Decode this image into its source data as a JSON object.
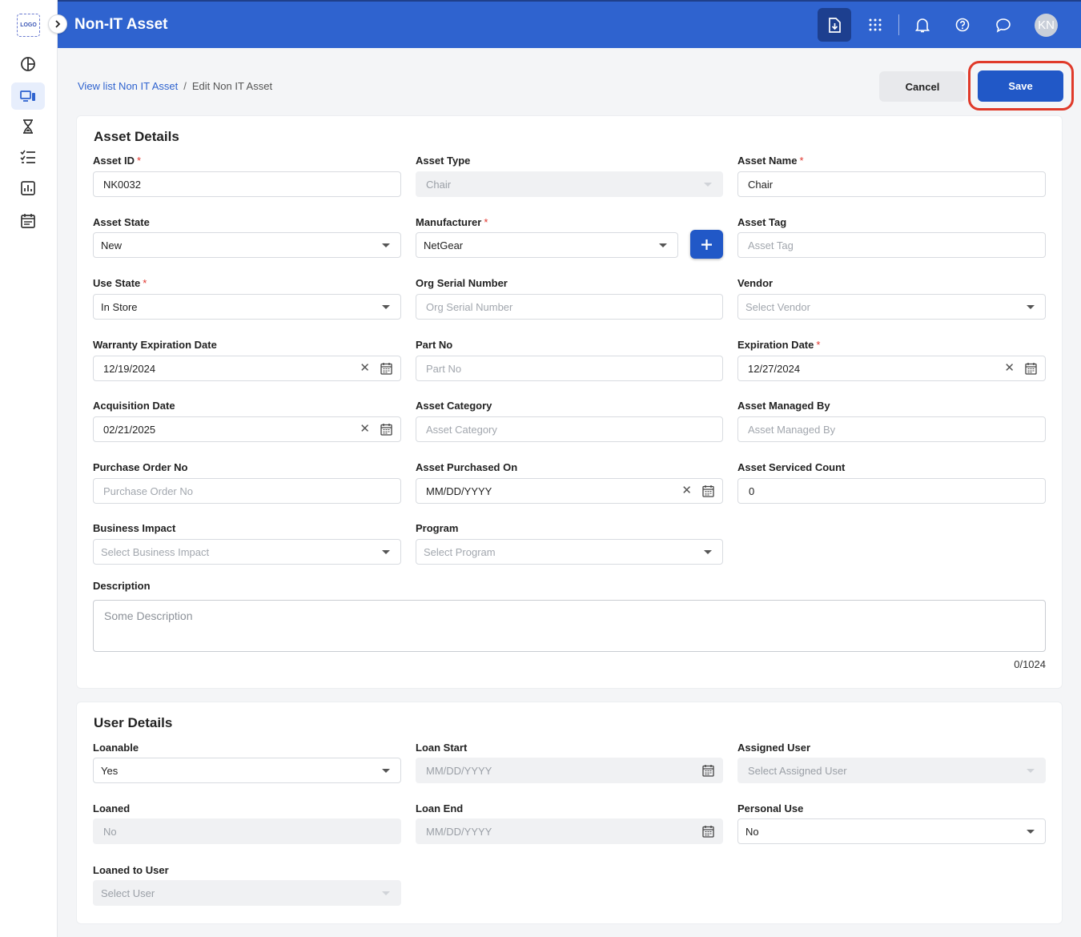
{
  "sidebar": {
    "logo_text": "LOGO",
    "items": [
      {
        "icon": "dashboard-pie-icon",
        "active": false
      },
      {
        "icon": "devices-icon",
        "active": true
      },
      {
        "icon": "hourglass-icon",
        "active": false
      },
      {
        "icon": "checklist-icon",
        "active": false
      },
      {
        "icon": "report-chart-icon",
        "active": false
      },
      {
        "icon": "calendar-icon",
        "active": false
      }
    ]
  },
  "header": {
    "title": "Non-IT Asset",
    "avatar_initials": "KN",
    "icons": [
      "download-file-icon",
      "apps-grid-icon",
      "bell-icon",
      "help-icon",
      "chat-icon"
    ]
  },
  "breadcrumb": {
    "parent": "View list Non IT Asset",
    "separator": "/",
    "current": "Edit Non IT Asset"
  },
  "actions": {
    "cancel_label": "Cancel",
    "save_label": "Save"
  },
  "asset_details": {
    "title": "Asset Details",
    "fields": {
      "asset_id": {
        "label": "Asset ID",
        "required": "*",
        "value": "NK0032"
      },
      "asset_type": {
        "label": "Asset Type",
        "value": "Chair"
      },
      "asset_name": {
        "label": "Asset Name",
        "required": "*",
        "value": "Chair"
      },
      "asset_state": {
        "label": "Asset State",
        "value": "New"
      },
      "manufacturer": {
        "label": "Manufacturer",
        "required": "*",
        "value": "NetGear"
      },
      "asset_tag": {
        "label": "Asset Tag",
        "placeholder": "Asset Tag"
      },
      "use_state": {
        "label": "Use State",
        "required": "*",
        "value": "In Store"
      },
      "org_serial": {
        "label": "Org Serial Number",
        "placeholder": "Org Serial Number"
      },
      "vendor": {
        "label": "Vendor",
        "placeholder": "Select Vendor"
      },
      "warranty_exp": {
        "label": "Warranty Expiration Date",
        "value": "12/19/2024"
      },
      "part_no": {
        "label": "Part No",
        "placeholder": "Part No"
      },
      "expiration_date": {
        "label": "Expiration Date",
        "required": "*",
        "value": "12/27/2024"
      },
      "acquisition_date": {
        "label": "Acquisition Date",
        "value": "02/21/2025"
      },
      "asset_category": {
        "label": "Asset Category",
        "placeholder": "Asset Category"
      },
      "asset_managed_by": {
        "label": "Asset Managed By",
        "placeholder": "Asset Managed By"
      },
      "purchase_order": {
        "label": "Purchase Order No",
        "placeholder": "Purchase Order No"
      },
      "purchased_on": {
        "label": "Asset Purchased On",
        "value": "MM/DD/YYYY"
      },
      "serviced_count": {
        "label": "Asset Serviced Count",
        "value": "0"
      },
      "business_impact": {
        "label": "Business Impact",
        "placeholder": "Select Business Impact"
      },
      "program": {
        "label": "Program",
        "placeholder": "Select Program"
      },
      "description": {
        "label": "Description",
        "placeholder": "Some Description",
        "count": "0/1024"
      }
    }
  },
  "user_details": {
    "title": "User Details",
    "fields": {
      "loanable": {
        "label": "Loanable",
        "value": "Yes"
      },
      "loan_start": {
        "label": "Loan Start",
        "placeholder": "MM/DD/YYYY"
      },
      "assigned_user": {
        "label": "Assigned User",
        "placeholder": "Select Assigned User"
      },
      "loaned": {
        "label": "Loaned",
        "value": "No"
      },
      "loan_end": {
        "label": "Loan End",
        "placeholder": "MM/DD/YYYY"
      },
      "personal_use": {
        "label": "Personal Use",
        "value": "No"
      },
      "loaned_to_user": {
        "label": "Loaned to User",
        "placeholder": "Select User"
      }
    }
  },
  "colors": {
    "primary": "#2f63cf",
    "save_button": "#2158c7",
    "required": "#e0342c",
    "highlight": "#e03a2a"
  }
}
